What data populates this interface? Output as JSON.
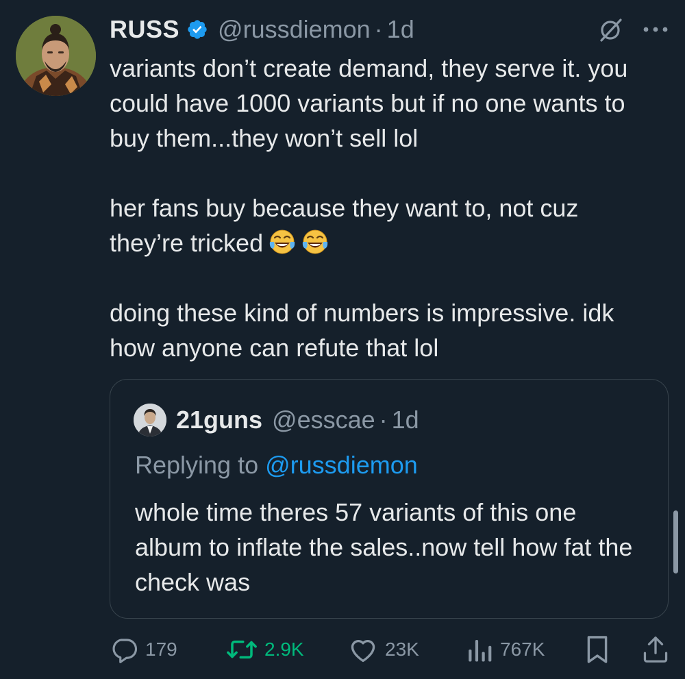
{
  "author": {
    "display_name": "RUSS",
    "handle": "@russdiemon",
    "separator": "·",
    "time": "1d"
  },
  "tweet": {
    "paragraphs": [
      "variants don’t create demand, they serve it. you could have 1000 variants but if no one wants to buy them...they won’t sell lol",
      "her fans buy because they want to, not cuz they’re tricked",
      "doing these kind of numbers is impressive. idk how anyone can refute that lol"
    ],
    "emoji": [
      "😂",
      "😂"
    ]
  },
  "quoted_tweet": {
    "display_name": "21guns",
    "handle": "@esscae",
    "separator": "·",
    "time": "1d",
    "replying_prefix": "Replying to",
    "replying_mention": "@russdiemon",
    "text": "whole time theres 57 variants of this one album to inflate the sales..now tell how fat the check was"
  },
  "actions": {
    "replies": "179",
    "retweets": "2.9K",
    "likes": "23K",
    "views": "767K"
  },
  "colors": {
    "background": "#15202b",
    "text": "#e7e9ea",
    "secondary": "#8b98a5",
    "accent": "#1d9bf0",
    "retweet": "#00ba7c",
    "border": "#38444d"
  }
}
